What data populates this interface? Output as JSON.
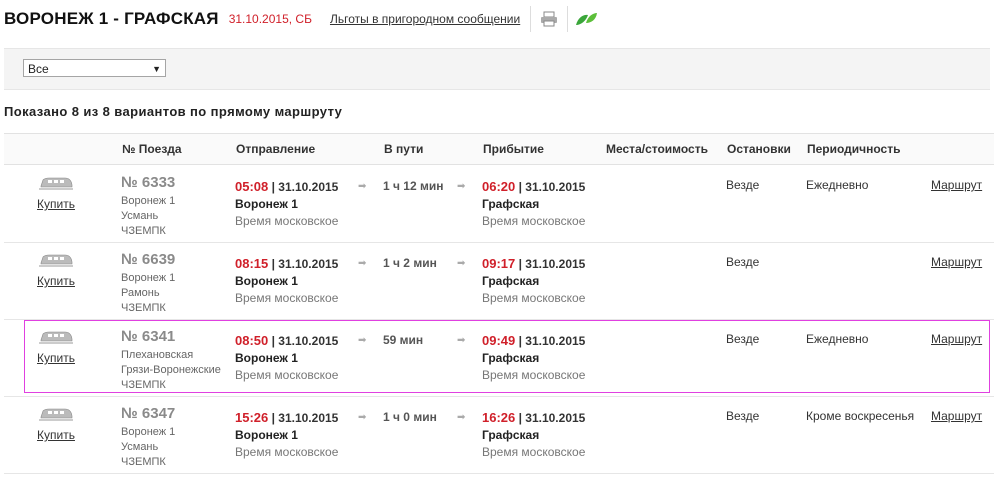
{
  "header": {
    "title": "ВОРОНЕЖ 1 - ГРАФСКАЯ",
    "date": "31.10.2015, СБ",
    "benefits_link": "Льготы в пригородном сообщении",
    "print_icon": "printer-icon",
    "eco_icon": "leaf-icon"
  },
  "filter": {
    "selected": "Все"
  },
  "summary": "Показано 8 из 8 вариантов по прямому маршруту",
  "columns": {
    "train": "№ Поезда",
    "departure": "Отправление",
    "travel": "В пути",
    "arrival": "Прибытие",
    "seats": "Места/стоимость",
    "stops": "Остановки",
    "periodicity": "Периодичность"
  },
  "rows": [
    {
      "buy": "Купить",
      "number": "№ 6333",
      "from": "Воронеж 1",
      "to": "Усмань",
      "carrier": "ЧЗЕМПК",
      "dep_time": "05:08",
      "dep_date": " | 31.10.2015",
      "dep_station": "Воронеж 1",
      "dep_tz": "Время московское",
      "travel": "1 ч 12 мин",
      "arr_time": "06:20",
      "arr_date": " | 31.10.2015",
      "arr_station": "Графская",
      "arr_tz": "Время московское",
      "stops": "Везде",
      "periodicity": "Ежедневно",
      "route": "Маршрут"
    },
    {
      "buy": "Купить",
      "number": "№ 6639",
      "from": "Воронеж 1",
      "to": "Рамонь",
      "carrier": "ЧЗЕМПК",
      "dep_time": "08:15",
      "dep_date": " | 31.10.2015",
      "dep_station": "Воронеж 1",
      "dep_tz": "Время московское",
      "travel": "1 ч 2 мин",
      "arr_time": "09:17",
      "arr_date": " | 31.10.2015",
      "arr_station": "Графская",
      "arr_tz": "Время московское",
      "stops": "Везде",
      "periodicity": "",
      "route": "Маршрут"
    },
    {
      "buy": "Купить",
      "number": "№ 6341",
      "from": "Плехановская",
      "to": "Грязи-Воронежские",
      "carrier": "ЧЗЕМПК",
      "dep_time": "08:50",
      "dep_date": " | 31.10.2015",
      "dep_station": "Воронеж 1",
      "dep_tz": "Время московское",
      "travel": "59 мин",
      "arr_time": "09:49",
      "arr_date": " | 31.10.2015",
      "arr_station": "Графская",
      "arr_tz": "Время московское",
      "stops": "Везде",
      "periodicity": "Ежедневно",
      "route": "Маршрут"
    },
    {
      "buy": "Купить",
      "number": "№ 6347",
      "from": "Воронеж 1",
      "to": "Усмань",
      "carrier": "ЧЗЕМПК",
      "dep_time": "15:26",
      "dep_date": " | 31.10.2015",
      "dep_station": "Воронеж 1",
      "dep_tz": "Время московское",
      "travel": "1 ч 0 мин",
      "arr_time": "16:26",
      "arr_date": " | 31.10.2015",
      "arr_station": "Графская",
      "arr_tz": "Время московское",
      "stops": "Везде",
      "periodicity": "Кроме воскресенья",
      "route": "Маршрут"
    }
  ],
  "train_icon": "train-icon",
  "arrow_icon": "arrow-right-icon",
  "colors": {
    "time": "#d0202a",
    "highlight": "#e040e0"
  }
}
